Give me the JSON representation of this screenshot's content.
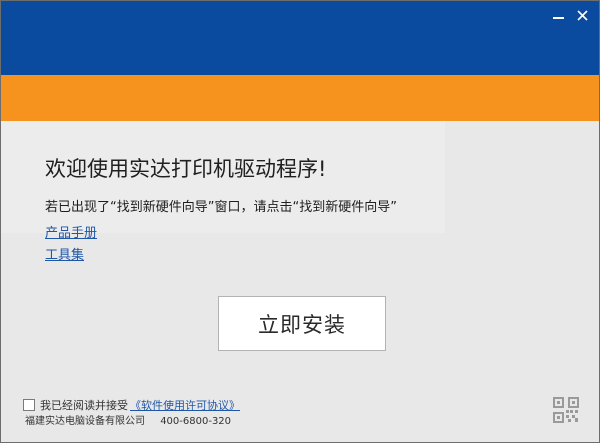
{
  "window": {
    "colors": {
      "title_bar": "#0a4a9f",
      "accent_band": "#f6931f",
      "background": "#e8e8e8",
      "link": "#1f57a8"
    },
    "controls": {
      "minimize_icon": "minimize-icon",
      "close_label": "✕"
    }
  },
  "main": {
    "heading": "欢迎使用实达打印机驱动程序!",
    "instruction": "若已出现了“找到新硬件向导”窗口，请点击“找到新硬件向导”",
    "links": {
      "manual": "产品手册",
      "tools": "工具集"
    },
    "install_button": "立即安装"
  },
  "footer": {
    "agree_text": "我已经阅读并接受",
    "license_link": "《软件使用许可协议》",
    "company": "福建实达电脑设备有限公司",
    "phone": "400-6800-320",
    "qr_icon": "qr-code-icon"
  }
}
